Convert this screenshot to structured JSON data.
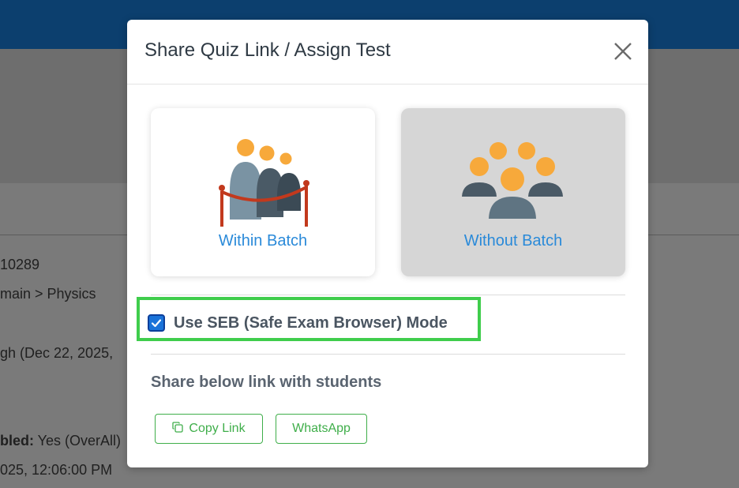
{
  "background": {
    "lines": [
      {
        "text": "10289"
      },
      {
        "text": "main > Physics"
      },
      {
        "text": "gh (Dec 22, 2025,"
      },
      {
        "bold": "bled:",
        "text": " Yes (OverAll)"
      },
      {
        "text": "025, 12:06:00 PM"
      }
    ]
  },
  "modal": {
    "title": "Share Quiz Link / Assign Test",
    "cards": {
      "within": {
        "label": "Within Batch",
        "icon": "batch-group-icon"
      },
      "without": {
        "label": "Without Batch",
        "icon": "people-group-icon"
      }
    },
    "seb": {
      "label": "Use SEB (Safe Exam Browser) Mode",
      "checked": true
    },
    "share_label": "Share below link with students",
    "buttons": {
      "copy_link": "Copy Link",
      "whatsapp": "WhatsApp"
    }
  },
  "colors": {
    "accent_blue": "#2a8ad9",
    "highlight_green": "#3fcd4c",
    "button_green": "#3fae4a",
    "header_blue": "#0c3f6e"
  }
}
